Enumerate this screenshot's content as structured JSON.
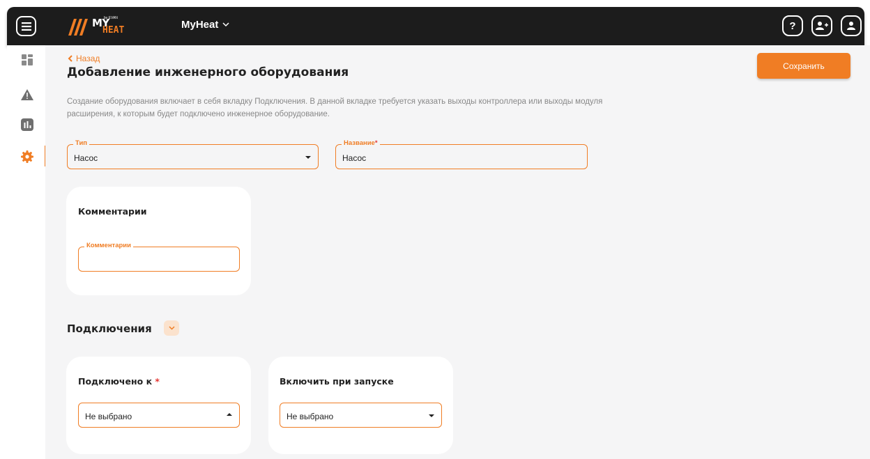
{
  "header": {
    "logo": {
      "my": "MY",
      "heat": "HEAT",
      "by": "by EVAN"
    },
    "app_name": "MyHeat",
    "help_icon_label": "?"
  },
  "sidebar": {
    "items": [
      {
        "icon": "dashboard-icon",
        "active": false
      },
      {
        "icon": "warning-icon",
        "active": false
      },
      {
        "icon": "chart-icon",
        "active": false
      },
      {
        "icon": "gear-icon",
        "active": true
      }
    ]
  },
  "page": {
    "back_label": "Назад",
    "title": "Добавление инженерного оборудования",
    "save_label": "Сохранить",
    "description": "Создание оборудования включает в себя вкладку Подключения. В данной вкладке требуется указать выходы контроллера или выходы модуля расширения, к которым будет подключено инженерное оборудование."
  },
  "form": {
    "type": {
      "label": "Тип",
      "value": "Насос"
    },
    "name": {
      "label": "Название",
      "required_mark": "*",
      "value": "Насос"
    }
  },
  "comments_card": {
    "title": "Комментарии",
    "field": {
      "label": "Комментарии",
      "value": ""
    }
  },
  "connections": {
    "title": "Подключения",
    "connected_to": {
      "title": "Подключено к",
      "required_mark": "*",
      "value": "Не выбрано"
    },
    "enable_on_start": {
      "title": "Включить при запуске",
      "value": "Не выбрано"
    }
  },
  "colors": {
    "accent": "#f07d24",
    "header_bg": "#1c1c1c",
    "content_bg": "#f5f5f6",
    "required": "#e53935"
  }
}
